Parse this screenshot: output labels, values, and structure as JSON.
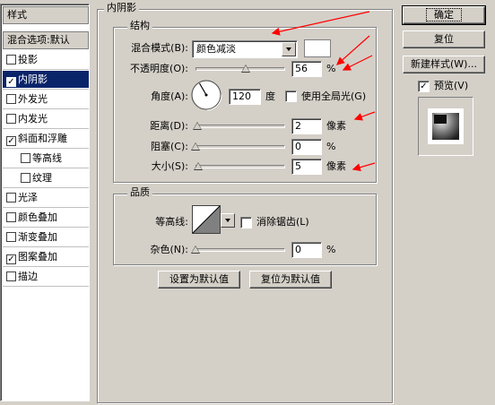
{
  "left_panel": {
    "header_styles": "样式",
    "header_blending": "混合选项:默认",
    "items": [
      {
        "label": "投影",
        "checked": false,
        "indent": false,
        "selected": false
      },
      {
        "label": "内阴影",
        "checked": true,
        "indent": false,
        "selected": true
      },
      {
        "label": "外发光",
        "checked": false,
        "indent": false,
        "selected": false
      },
      {
        "label": "内发光",
        "checked": false,
        "indent": false,
        "selected": false
      },
      {
        "label": "斜面和浮雕",
        "checked": true,
        "indent": false,
        "selected": false
      },
      {
        "label": "等高线",
        "checked": false,
        "indent": true,
        "selected": false
      },
      {
        "label": "纹理",
        "checked": false,
        "indent": true,
        "selected": false
      },
      {
        "label": "光泽",
        "checked": false,
        "indent": false,
        "selected": false
      },
      {
        "label": "颜色叠加",
        "checked": false,
        "indent": false,
        "selected": false
      },
      {
        "label": "渐变叠加",
        "checked": false,
        "indent": false,
        "selected": false
      },
      {
        "label": "图案叠加",
        "checked": true,
        "indent": false,
        "selected": false
      },
      {
        "label": "描边",
        "checked": false,
        "indent": false,
        "selected": false
      }
    ]
  },
  "inner_shadow": {
    "panel_title": "内阴影",
    "structure": {
      "title": "结构",
      "blend_mode_label": "混合模式(B):",
      "blend_mode_value": "颜色减淡",
      "shadow_color": "#ffffff",
      "opacity_label": "不透明度(O):",
      "opacity_value": "56",
      "opacity_unit": "%",
      "opacity_fraction": 0.56,
      "angle_label": "角度(A):",
      "angle_value": "120",
      "angle_unit": "度",
      "global_light_label": "使用全局光(G)",
      "global_light_checked": false,
      "distance_label": "距离(D):",
      "distance_value": "2",
      "distance_unit": "像素",
      "distance_fraction": 0.02,
      "choke_label": "阻塞(C):",
      "choke_value": "0",
      "choke_unit": "%",
      "choke_fraction": 0,
      "size_label": "大小(S):",
      "size_value": "5",
      "size_unit": "像素",
      "size_fraction": 0.03
    },
    "quality": {
      "title": "品质",
      "contour_label": "等高线:",
      "anti_alias_label": "消除锯齿(L)",
      "anti_alias_checked": false,
      "noise_label": "杂色(N):",
      "noise_value": "0",
      "noise_unit": "%",
      "noise_fraction": 0
    },
    "set_default_label": "设置为默认值",
    "reset_default_label": "复位为默认值"
  },
  "right_buttons": {
    "ok_label": "确定",
    "reset_label": "复位",
    "new_style_label": "新建样式(W)...",
    "preview_label": "预览(V)",
    "preview_checked": true
  },
  "colors": {
    "dialog_bg": "#d4d0c8",
    "selection": "#0a246a",
    "annotation_arrow": "#ff0000"
  }
}
